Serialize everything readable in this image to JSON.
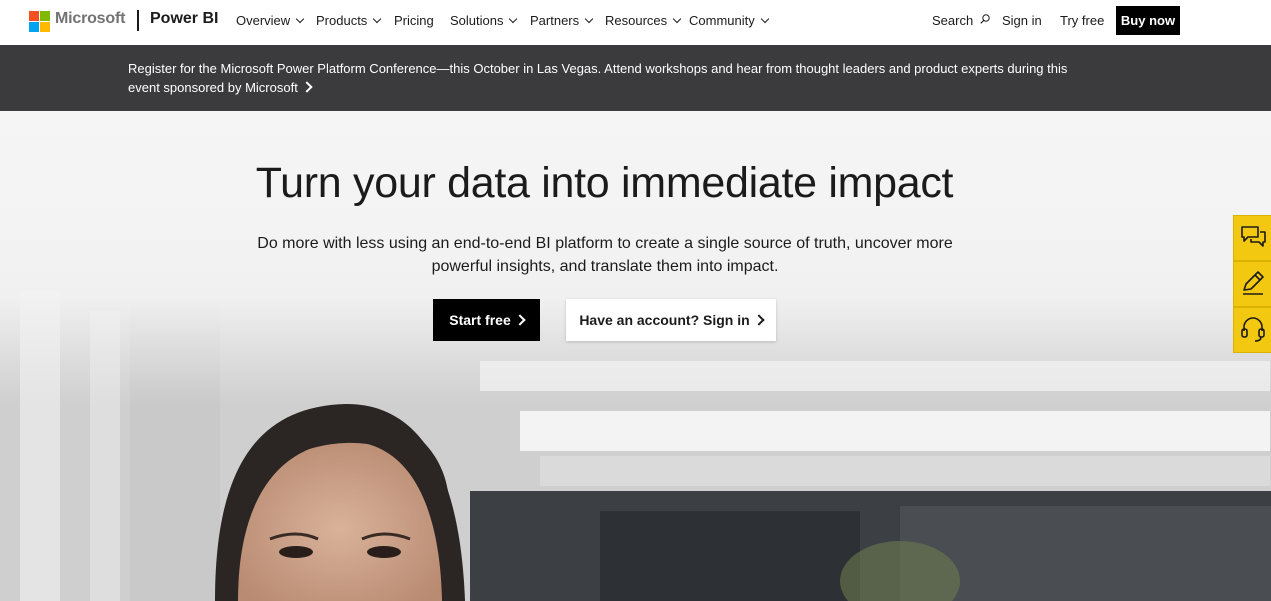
{
  "header": {
    "brand": "Microsoft",
    "product": "Power BI",
    "nav": [
      {
        "label": "Overview",
        "dropdown": true
      },
      {
        "label": "Products",
        "dropdown": true
      },
      {
        "label": "Pricing",
        "dropdown": false
      },
      {
        "label": "Solutions",
        "dropdown": true
      },
      {
        "label": "Partners",
        "dropdown": true
      },
      {
        "label": "Resources",
        "dropdown": true
      },
      {
        "label": "Community",
        "dropdown": true
      }
    ],
    "search_label": "Search",
    "sign_in": "Sign in",
    "try_free": "Try free",
    "buy_now": "Buy now"
  },
  "banner": {
    "text": "Register for the Microsoft Power Platform Conference—this October in Las Vegas. Attend workshops and hear from thought leaders and product experts during this event sponsored by Microsoft"
  },
  "hero": {
    "title": "Turn your data into immediate impact",
    "subtitle": "Do more with less using an end-to-end BI platform to create a single source of truth, uncover more powerful insights, and translate them into impact.",
    "primary_button": "Start free",
    "secondary_button": "Have an account? Sign in"
  },
  "side_rail": {
    "items": [
      "chat-icon",
      "pencil-icon",
      "headset-icon"
    ],
    "color": "#f2c811"
  },
  "colors": {
    "banner_bg": "#3b3a3c",
    "button_dark": "#000000",
    "microsoft_logo": [
      "#f25022",
      "#7fba00",
      "#00a4ef",
      "#ffb900"
    ]
  }
}
